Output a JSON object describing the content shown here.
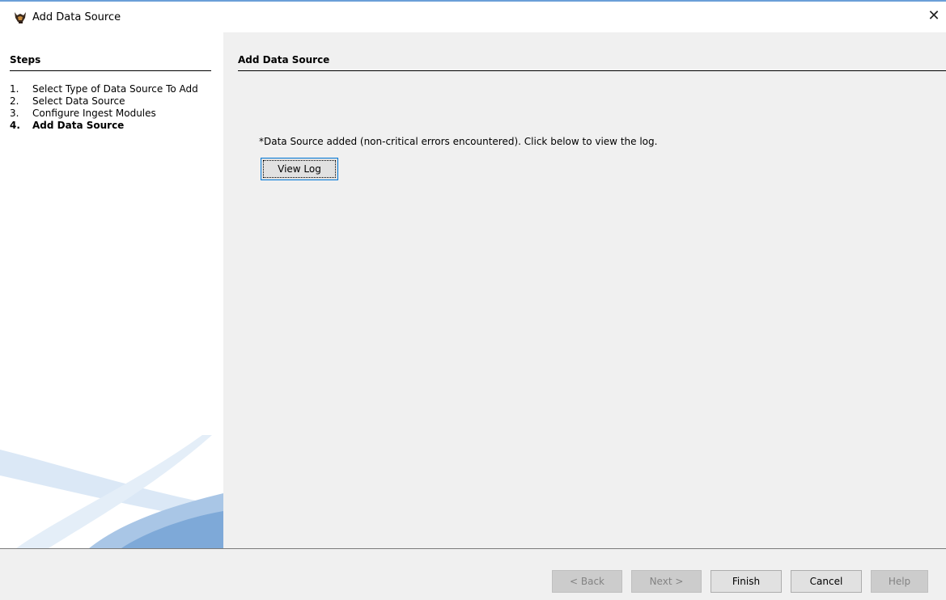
{
  "window": {
    "title": "Add Data Source",
    "icon": "autopsy-dog-icon",
    "close_glyph": "✕"
  },
  "steps": {
    "title": "Steps",
    "items": [
      {
        "num": "1.",
        "label": "Select Type of Data Source To Add"
      },
      {
        "num": "2.",
        "label": "Select Data Source"
      },
      {
        "num": "3.",
        "label": "Configure Ingest Modules"
      },
      {
        "num": "4.",
        "label": "Add Data Source"
      }
    ],
    "active_index": 3
  },
  "panel": {
    "title": "Add Data Source",
    "message": "*Data Source added (non-critical errors encountered). Click below to view the log.",
    "view_log_label": "View Log"
  },
  "footer": {
    "back": "< Back",
    "next": "Next >",
    "finish": "Finish",
    "cancel": "Cancel",
    "help": "Help"
  },
  "colors": {
    "panel_bg": "#f0f0f0",
    "focus_border": "#0078d7",
    "disabled_text": "#838383",
    "swoosh": "#a9c6e6"
  }
}
